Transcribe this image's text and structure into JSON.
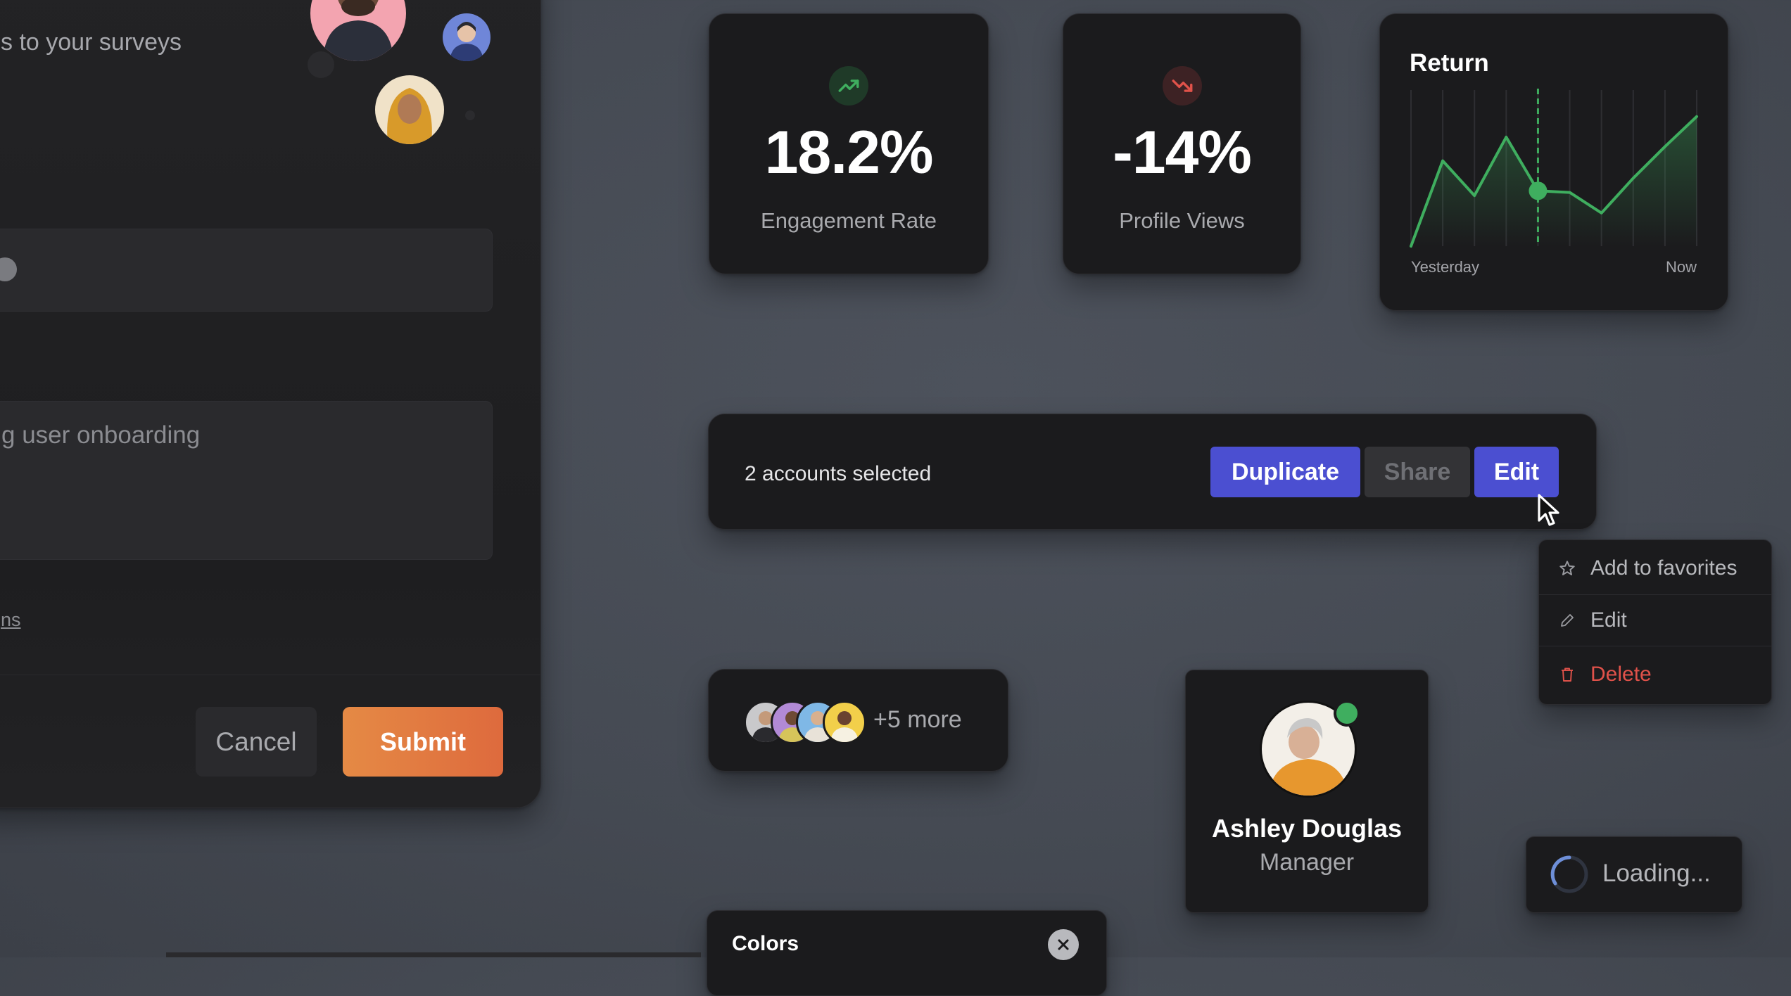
{
  "survey": {
    "subtitle": "s to your surveys",
    "field_1_value": "",
    "field_2_value": "g user onboarding",
    "link_text": "ns",
    "cancel_label": "Cancel",
    "submit_label": "Submit"
  },
  "stats": [
    {
      "value": "18.2%",
      "label": "Engagement Rate",
      "trend": "up",
      "icon": "trending-up-icon",
      "color": "#3fae5f"
    },
    {
      "value": "-14%",
      "label": "Profile Views",
      "trend": "down",
      "icon": "trending-down-icon",
      "color": "#e0524a"
    }
  ],
  "return_chart": {
    "title": "Return",
    "x_start_label": "Yesterday",
    "x_end_label": "Now",
    "accent": "#3fae5f"
  },
  "chart_data": {
    "type": "line",
    "title": "Return",
    "x": [
      "Yesterday",
      "",
      "",
      "",
      "",
      "",
      "",
      "",
      "",
      "Now"
    ],
    "values": [
      0,
      5.4,
      3.2,
      6.9,
      3.5,
      3.4,
      2.1,
      4.3,
      6.3,
      8.2
    ],
    "highlight_index": 4,
    "grid": true,
    "xlabel": "",
    "ylabel": ""
  },
  "selection": {
    "text": "2 accounts selected",
    "duplicate_label": "Duplicate",
    "share_label": "Share",
    "edit_label": "Edit"
  },
  "context_menu": {
    "items": [
      {
        "label": "Add to favorites",
        "icon": "star-icon"
      },
      {
        "label": "Edit",
        "icon": "pencil-icon"
      },
      {
        "label": "Delete",
        "icon": "trash-icon",
        "color": "#e0524a"
      }
    ]
  },
  "avatar_stack": {
    "more_label": "+5 more"
  },
  "profile": {
    "name": "Ashley Douglas",
    "role": "Manager",
    "status_color": "#3fae5f"
  },
  "loading": {
    "label": "Loading..."
  },
  "colors_panel": {
    "title": "Colors"
  }
}
